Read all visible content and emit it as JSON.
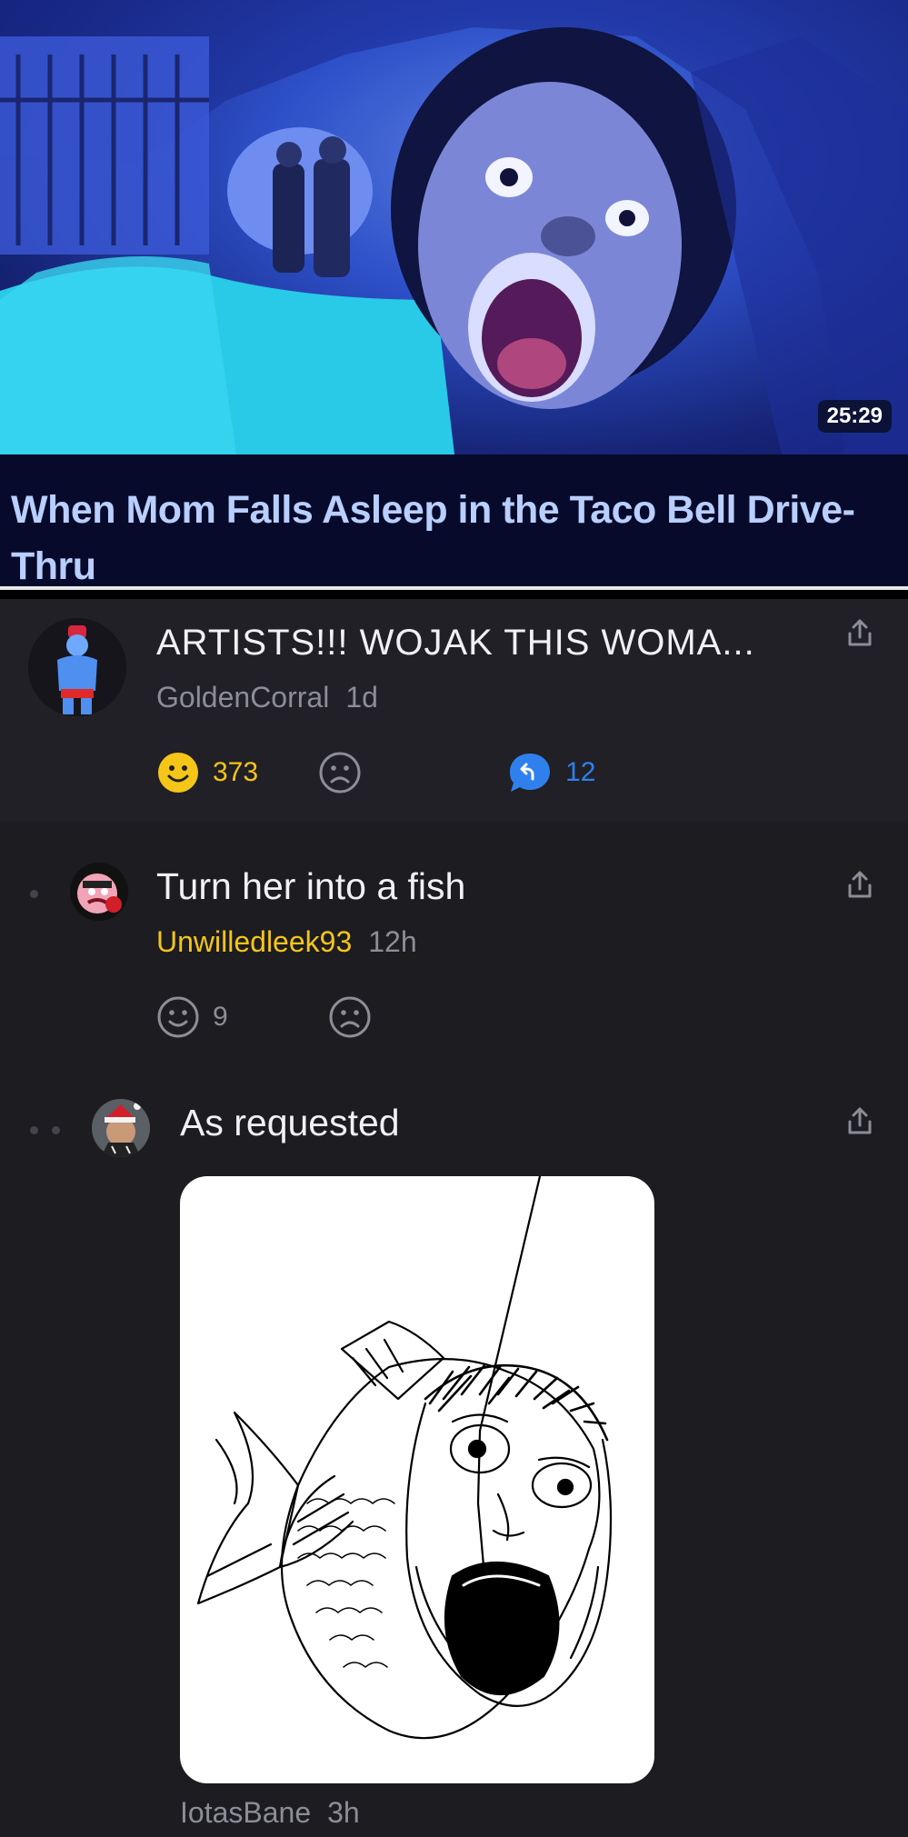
{
  "video": {
    "duration": "25:29",
    "title": "When Mom Falls Asleep in the Taco Bell Drive-Thru"
  },
  "post": {
    "title": "ARTISTS!!! WOJAK THIS WOMA...",
    "author": "GoldenCorral",
    "age": "1d",
    "like_count": "373",
    "reply_count": "12",
    "colors": {
      "like": "#f5c518",
      "reply": "#2f80ed"
    }
  },
  "comments": [
    {
      "text": "Turn her into a fish",
      "author": "Unwilledleek93",
      "age": "12h",
      "like_count": "9"
    },
    {
      "text": "As requested",
      "author": "IotasBane",
      "age": "3h",
      "attachment": "fish-wojak-drawing"
    }
  ]
}
